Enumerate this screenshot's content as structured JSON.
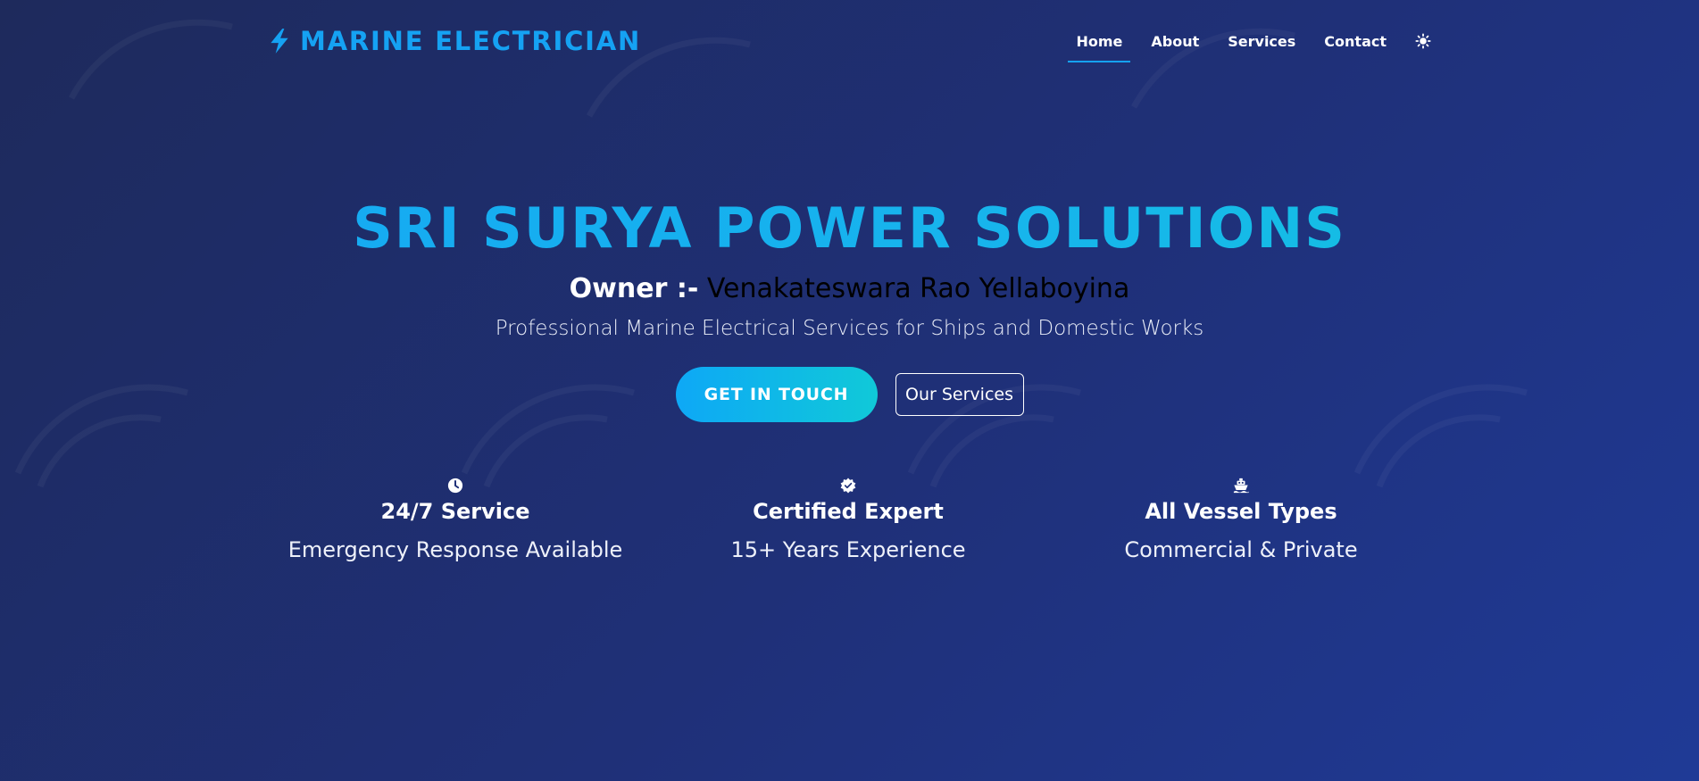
{
  "navbar": {
    "brand": "MARINE ELECTRICIAN",
    "links": [
      {
        "label": "Home",
        "active": true
      },
      {
        "label": "About",
        "active": false
      },
      {
        "label": "Services",
        "active": false
      },
      {
        "label": "Contact",
        "active": false
      }
    ],
    "theme_icon": "sun-icon"
  },
  "hero": {
    "title": "SRI SURYA POWER SOLUTIONS",
    "owner_label": "Owner :-",
    "owner_name": "Venakateswara Rao Yellaboyina",
    "tagline": "Professional Marine Electrical Services for Ships and Domestic Works",
    "primary_button": "GET IN TOUCH",
    "secondary_button": "Our Services"
  },
  "features": [
    {
      "icon": "clock-icon",
      "title": "24/7 Service",
      "desc": "Emergency Response Available"
    },
    {
      "icon": "certificate-icon",
      "title": "Certified Expert",
      "desc": "15+ Years Experience"
    },
    {
      "icon": "ship-icon",
      "title": "All Vessel Types",
      "desc": "Commercial & Private"
    }
  ],
  "colors": {
    "accent": "#15a2f3",
    "accent_cyan": "#10c9d8",
    "background": "#1f3078"
  }
}
